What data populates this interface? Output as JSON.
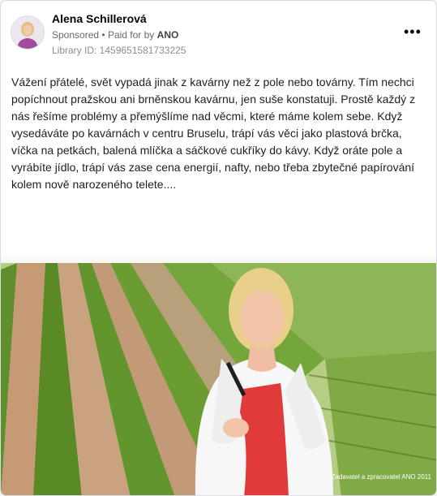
{
  "post": {
    "author": "Alena Schillerová",
    "sponsored_label": "Sponsored",
    "paid_for_prefix": "Paid for by",
    "paid_for_by": "ANO",
    "library_id": "Library ID: 1459651581733225",
    "more_icon": "more-options-icon",
    "text": "Vážení přátelé, svět vypadá jinak z kavárny než z pole nebo továrny. Tím nechci popíchnout pražskou ani brněnskou kavárnu, jen suše konstatuji. Prostě každý z nás řešíme problémy a přemýšlíme nad věcmi, které máme kolem sebe. Když vysedáváte po kavárnách v centru Bruselu, trápí vás věci jako plastová brčka, víčka na petkách, balená mlíčka a sáčkové cukříky do kávy. Když oráte pole a vyrábíte jídlo, trápí vás zase cena energií, nafty, nebo třeba zbytečné papírování kolem nově narozeného telete....",
    "image_caption": "Zadavatel a zpracovatel ANO 2011"
  }
}
